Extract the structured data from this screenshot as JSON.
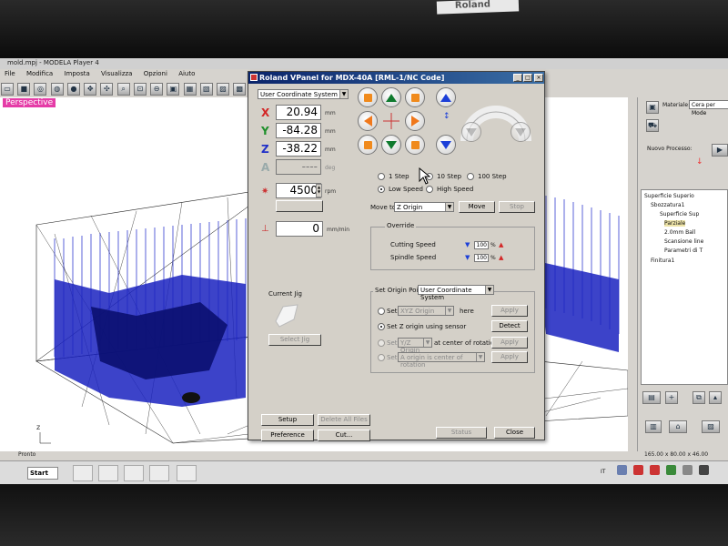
{
  "app": {
    "window_title": "mold.mpj - MODELA Player 4",
    "menu": [
      "File",
      "Modifica",
      "Imposta",
      "Visualizza",
      "Opzioni",
      "Aiuto"
    ],
    "viewport_label": "Perspective",
    "status_text": "Pronto",
    "dimensions_text": "165.00 x 80.00 x 46.00"
  },
  "right_panel": {
    "material_label": "Materiale:",
    "material_value": "Cera per Mode",
    "new_process_label": "Nuovo Processo:",
    "tree": [
      "Superficie Superio",
      "Sbozzatura1",
      "Superficie Sup",
      "Parziale",
      "2.0mm Ball",
      "Scansione line",
      "Parametri di T",
      "Finitura1"
    ]
  },
  "taskbar": {
    "start_label": "Start",
    "tray_lang": "IT"
  },
  "vpanel": {
    "title": "Roland VPanel for MDX-40A [RML-1/NC Code]",
    "coord_system": "User Coordinate System",
    "x_label": "X",
    "y_label": "Y",
    "z_label": "Z",
    "a_label": "A",
    "x_value": "20.94",
    "y_value": "-84.28",
    "z_value": "-38.22",
    "a_value": "----",
    "unit_mm": "mm",
    "unit_deg": "deg",
    "spindle_value": "4500",
    "unit_rpm": "rpm",
    "feed_value": "0",
    "unit_feed": "mm/min",
    "step_1": "1 Step",
    "step_10": "10 Step",
    "step_100": "100 Step",
    "low_speed": "Low Speed",
    "high_speed": "High Speed",
    "move_to_label": "Move to",
    "move_to_value": "Z Origin",
    "move_button": "Move",
    "stop_button": "Stop",
    "override_title": "Override",
    "cutting_speed_label": "Cutting Speed",
    "cutting_speed_value": "100",
    "spindle_speed_label": "Spindle Speed",
    "spindle_speed_value": "100",
    "pct": "%",
    "current_jig_label": "Current Jig",
    "select_jig_button": "Select Jig",
    "set_origin_label": "Set Origin Point",
    "set_origin_value": "User Coordinate System",
    "set_label": "Set",
    "set_combo_value": "XYZ Origin",
    "here_label": "here",
    "apply_button": "Apply",
    "z_sensor_label": "Set Z origin using sensor",
    "detect_button": "Detect",
    "set_y_combo": "Y/Z Origin",
    "center_rotation_label": "at center of rotation",
    "apply2_button": "Apply",
    "set_a_combo": "A origin is center of rotation",
    "apply3_button": "Apply",
    "setup_button": "Setup",
    "preference_button": "Preference",
    "cut_button": "Cut...",
    "delete_button": "Delete All Files",
    "status_button": "Status",
    "close_button": "Close"
  },
  "colors": {
    "accent_blue": "#0a246a",
    "jog_green": "#0f7a2e",
    "jog_orange": "#f0781c",
    "jog_blue": "#1c3fd8",
    "x_red": "#d32626",
    "y_green": "#1e8f2a",
    "z_blue": "#2030c8"
  }
}
